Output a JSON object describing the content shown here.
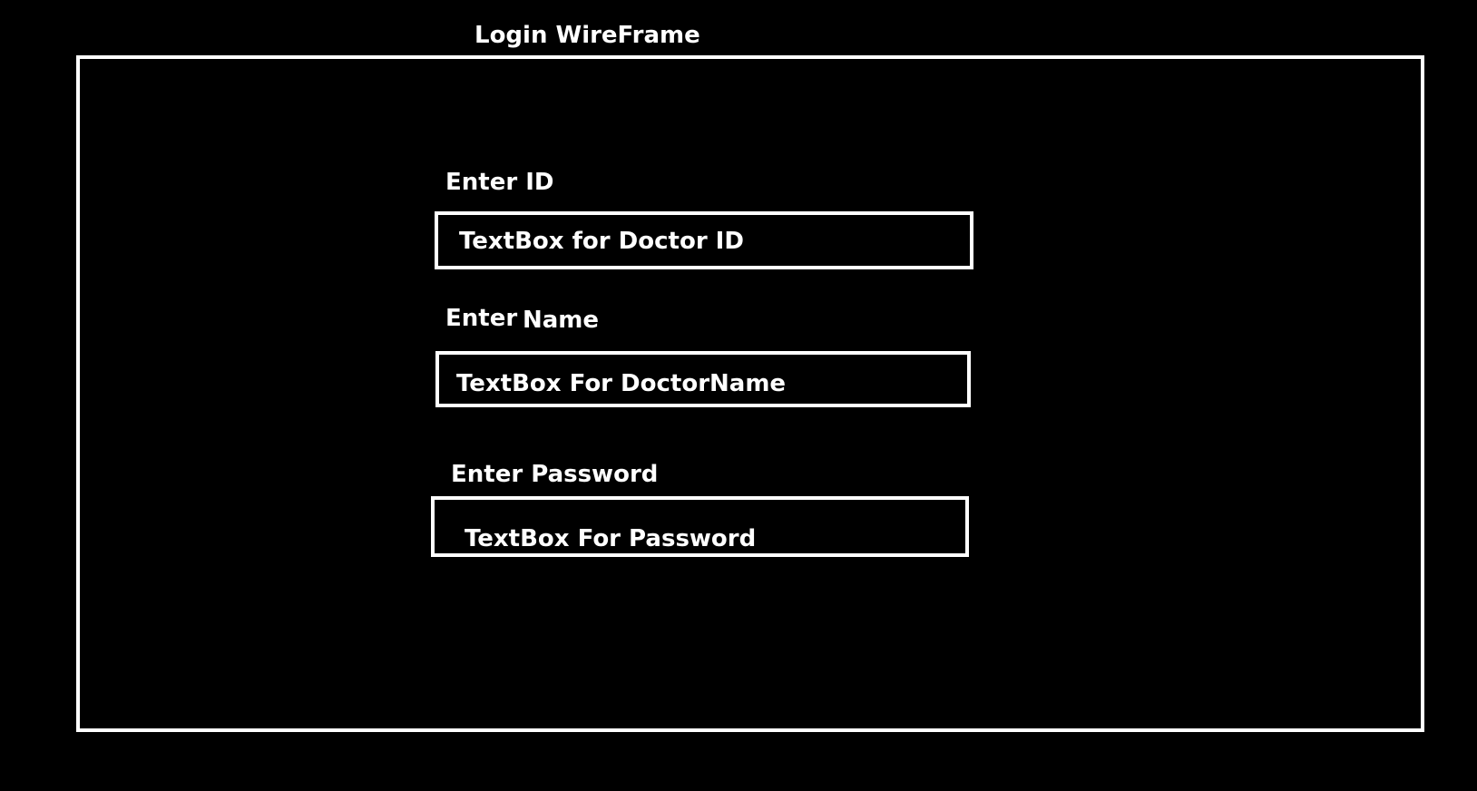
{
  "window": {
    "title": "Login WireFrame"
  },
  "form": {
    "id_field": {
      "label": "Enter ID",
      "placeholder": "TextBox for Doctor ID"
    },
    "name_field": {
      "label_part1": "Enter",
      "label_part2": "Name",
      "placeholder": "TextBox For DoctorName"
    },
    "password_field": {
      "label": "Enter Password",
      "placeholder": "TextBox For Password"
    }
  },
  "colors": {
    "background": "#000000",
    "foreground": "#ffffff"
  }
}
